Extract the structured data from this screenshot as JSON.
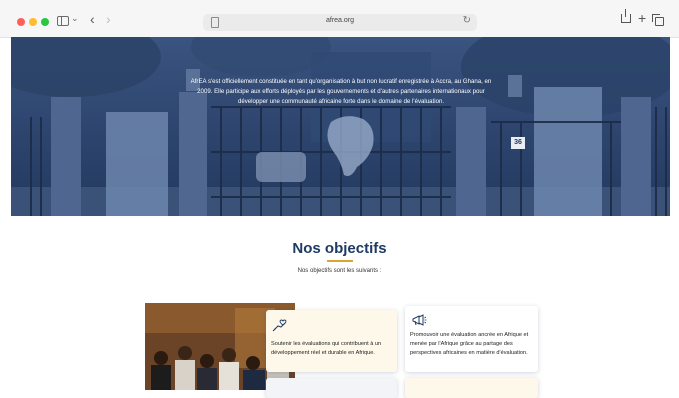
{
  "browser": {
    "url": "afrea.org"
  },
  "hero": {
    "text": "AfrEA s'est officiellement constituée en tant qu'organisation à but non lucratif enregistrée à Accra, au Ghana, en 2009. Elle participe aux efforts déployés par les gouvernements et d'autres partenaires internationaux pour développer une communauté africaine forte dans le domaine de l'évaluation.",
    "gate_number": "36"
  },
  "objectives": {
    "title": "Nos objectifs",
    "subtitle": "Nos objectifs sont les suivants :",
    "cards": [
      {
        "icon": "hands-heart-icon",
        "text": "Soutenir les évaluations qui contribuent à un développement réel et durable en Afrique."
      },
      {
        "icon": "megaphone-icon",
        "text": "Promouvoir une évaluation ancrée en Afrique et menée par l'Afrique grâce au partage des perspectives africaines en matière d'évaluation."
      }
    ]
  },
  "colors": {
    "hero_overlay": "#2a4068",
    "title": "#1f3a63",
    "accent": "#d9a634",
    "card_bg": "#fdf8ea"
  }
}
